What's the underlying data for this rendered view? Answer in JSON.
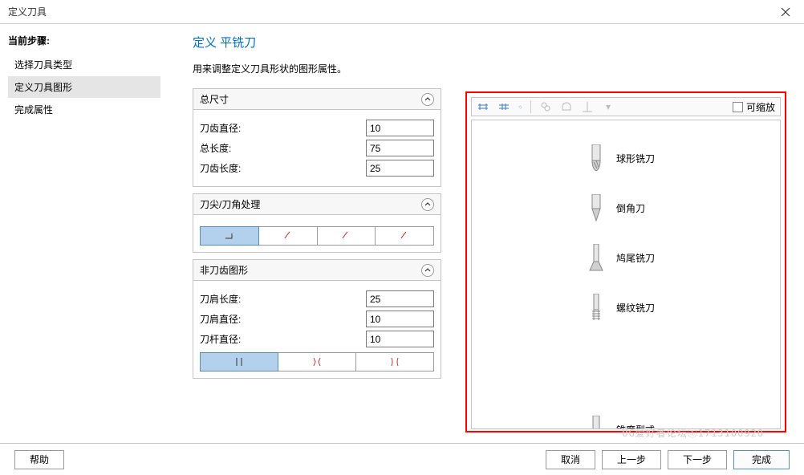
{
  "window": {
    "title": "定义刀具"
  },
  "sidebar": {
    "header": "当前步骤:",
    "steps": [
      {
        "label": "选择刀具类型",
        "selected": false
      },
      {
        "label": "定义刀具图形",
        "selected": true
      },
      {
        "label": "完成属性",
        "selected": false
      }
    ]
  },
  "content": {
    "title": "定义 平铣刀",
    "description": "用来调整定义刀具形状的图形属性。"
  },
  "panel_overall": {
    "title": "总尺寸",
    "rows": [
      {
        "label": "刀齿直径:",
        "value": "10"
      },
      {
        "label": "总长度:",
        "value": "75"
      },
      {
        "label": "刀齿长度:",
        "value": "25"
      }
    ]
  },
  "panel_tip": {
    "title": "刀尖/刀角处理"
  },
  "panel_body": {
    "title": "非刀齿图形",
    "rows": [
      {
        "label": "刀肩长度:",
        "value": "25"
      },
      {
        "label": "刀肩直径:",
        "value": "10"
      },
      {
        "label": "刀杆直径:",
        "value": "10"
      }
    ]
  },
  "preview": {
    "scalable_label": "可缩放",
    "tools": [
      {
        "label": "球形铣刀",
        "icon": "ball"
      },
      {
        "label": "倒角刀",
        "icon": "chamfer"
      },
      {
        "label": "鸠尾铣刀",
        "icon": "dovetail"
      },
      {
        "label": "螺纹铣刀",
        "icon": "thread"
      },
      {
        "label": "锥度型式",
        "icon": "taper"
      }
    ]
  },
  "footer": {
    "help": "帮助",
    "cancel": "取消",
    "prev": "上一步",
    "next": "下一步",
    "finish": "完成"
  },
  "watermark": "UG爱好者论坛①1713100920"
}
